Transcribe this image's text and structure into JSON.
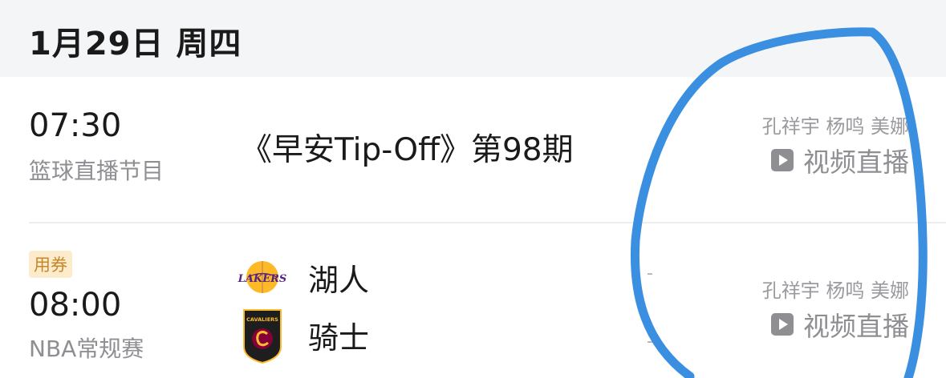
{
  "header": {
    "date": "1月29日 周四"
  },
  "schedule": [
    {
      "time": "07:30",
      "category": "篮球直播节目",
      "title": "《早安Tip-Off》第98期",
      "hosts": "孔祥宇 杨鸣 美娜",
      "action_label": "视频直播",
      "action_icon": "play-icon"
    },
    {
      "badge": "用券",
      "time": "08:00",
      "category": "NBA常规赛",
      "teams": [
        {
          "name": "湖人",
          "logo_text": "LAKERS",
          "logo_icon": "lakers-logo",
          "score": "-",
          "colors": [
            "#552583",
            "#fdb927"
          ]
        },
        {
          "name": "骑士",
          "logo_text": "CAVALIERS",
          "logo_icon": "cavaliers-logo",
          "score": "-",
          "colors": [
            "#1e1e1e",
            "#860038",
            "#fdbb30"
          ]
        }
      ],
      "hosts": "孔祥宇 杨鸣 美娜",
      "action_label": "视频直播",
      "action_icon": "play-icon"
    }
  ],
  "annotation_color": "#3b8fe0"
}
